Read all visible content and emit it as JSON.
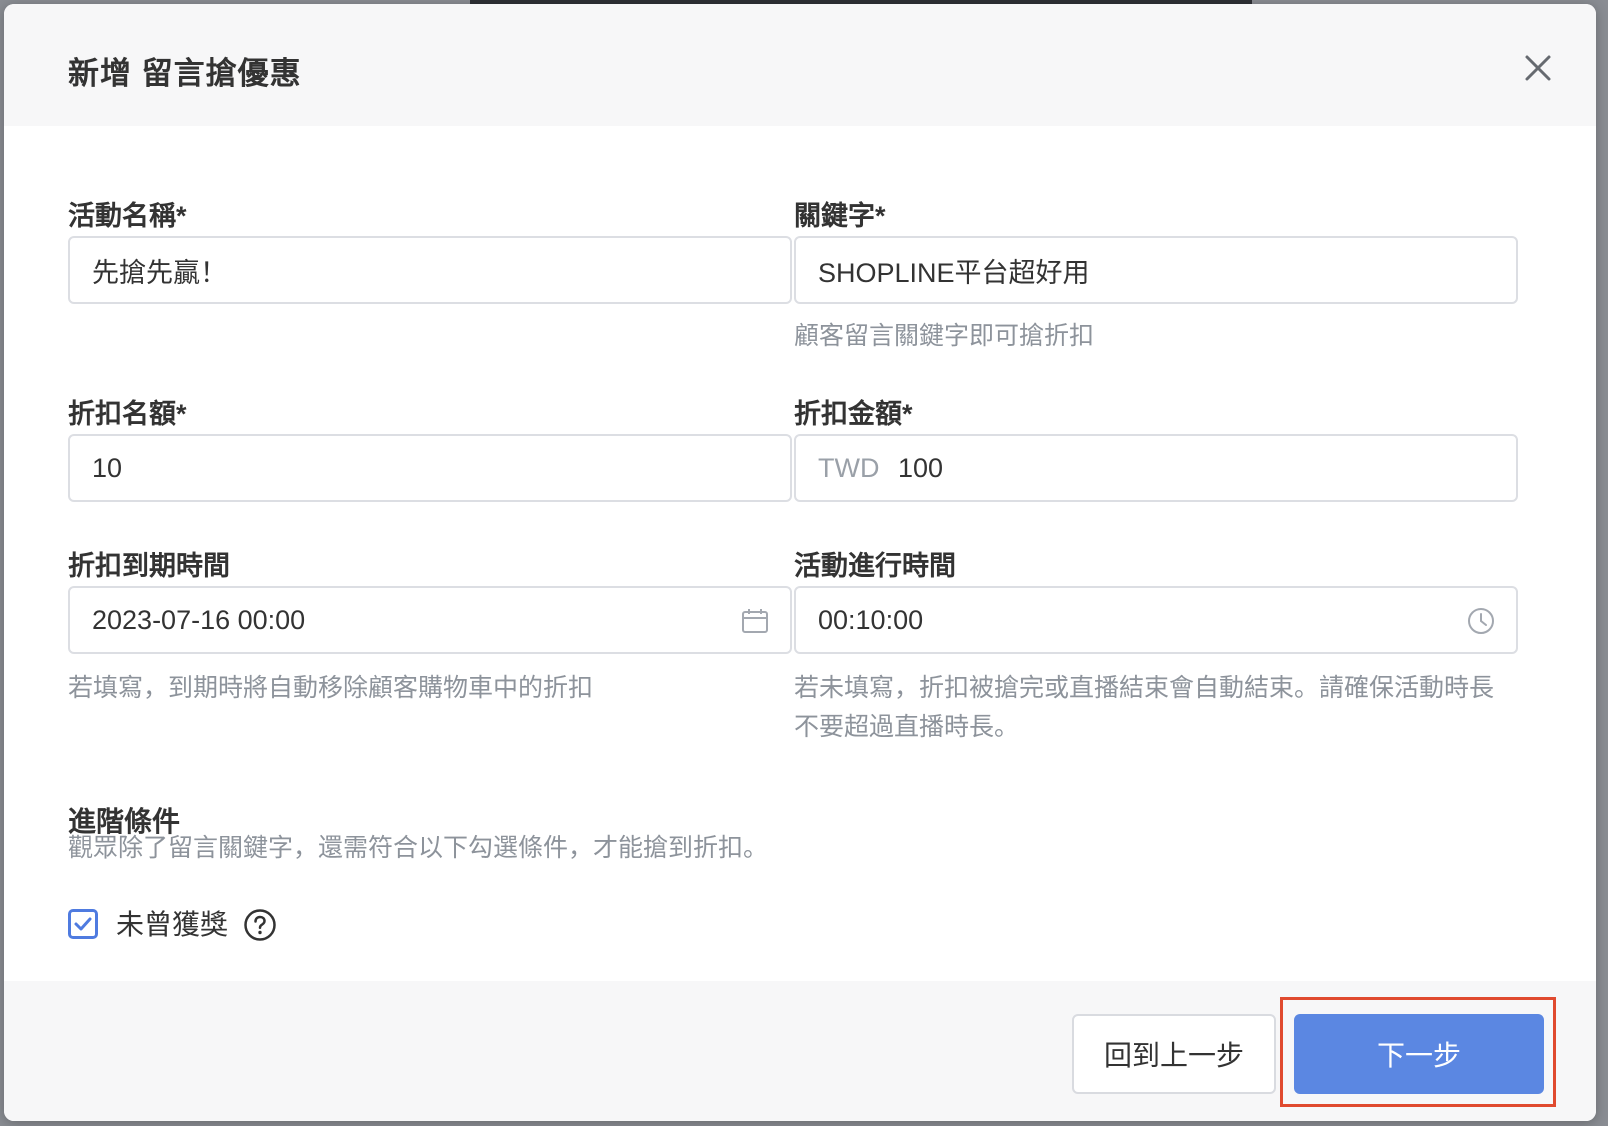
{
  "modal": {
    "title": "新增 留言搶優惠"
  },
  "form": {
    "activity_name": {
      "label": "活動名稱*",
      "value": "先搶先贏！"
    },
    "keyword": {
      "label": "關鍵字*",
      "value": "SHOPLINE平台超好用",
      "hint": "顧客留言關鍵字即可搶折扣"
    },
    "discount_quota": {
      "label": "折扣名額*",
      "value": "10"
    },
    "discount_amount": {
      "label": "折扣金額*",
      "currency": "TWD",
      "value": "100"
    },
    "discount_expiry": {
      "label": "折扣到期時間",
      "value": "2023-07-16 00:00",
      "hint": "若填寫，到期時將自動移除顧客購物車中的折扣",
      "icon": "calendar-icon"
    },
    "activity_duration": {
      "label": "活動進行時間",
      "value": "00:10:00",
      "hint_line1": "若未填寫，折扣被搶完或直播結束會自動結束。請確保活動時長",
      "hint_line2": "不要超過直播時長。",
      "icon": "clock-icon"
    }
  },
  "advanced": {
    "title": "進階條件",
    "description": "觀眾除了留言關鍵字，還需符合以下勾選條件，才能搶到折扣。",
    "conditions": [
      {
        "label": "未曾獲獎",
        "checked": true,
        "icon": "help-icon"
      }
    ]
  },
  "footer": {
    "back_label": "回到上一步",
    "next_label": "下一步"
  },
  "colors": {
    "primary": "#5b87e2",
    "highlight": "#e04a2f",
    "checkbox": "#4f7be0"
  }
}
